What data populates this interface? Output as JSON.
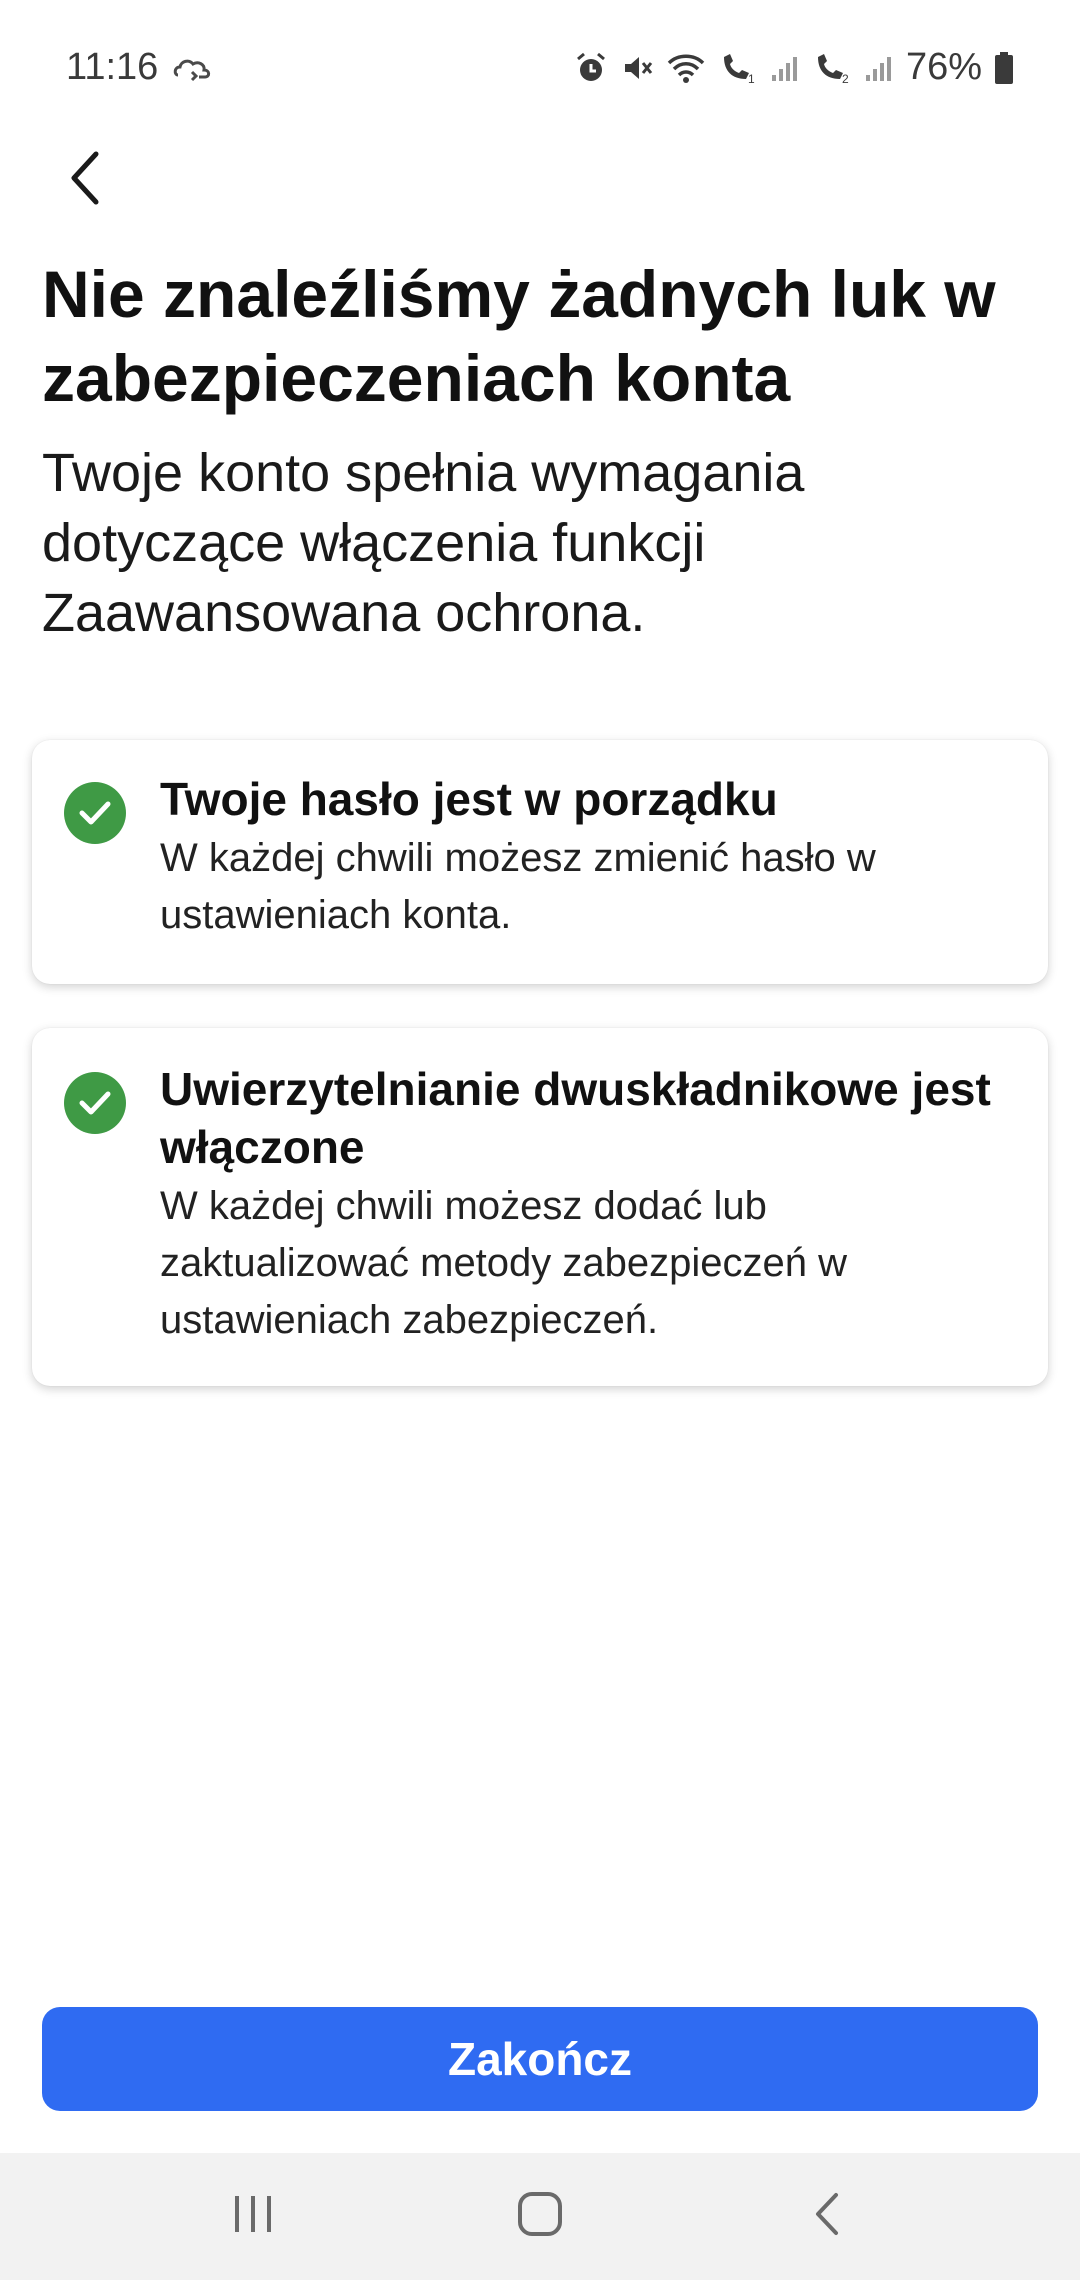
{
  "status_bar": {
    "time": "11:16",
    "battery_percent": "76%",
    "icons": [
      "cloud-sync-icon",
      "alarm-icon",
      "mute-icon",
      "wifi-icon",
      "call-sim1-icon",
      "signal-icon",
      "call-sim2-icon",
      "signal-icon",
      "battery-icon"
    ]
  },
  "header": {
    "back_icon": "chevron-left-icon"
  },
  "main": {
    "title": "Nie znaleźliśmy żadnych luk w zabezpieczeniach konta",
    "subtitle": "Twoje konto spełnia wymagania dotyczące włączenia funkcji Zaawansowana ochrona.",
    "checks": [
      {
        "icon": "check-circle-icon",
        "title": "Twoje hasło jest w porządku",
        "description": "W każdej chwili możesz zmienić hasło w ustawieniach konta."
      },
      {
        "icon": "check-circle-icon",
        "title": "Uwierzytelnianie dwuskładnikowe jest włączone",
        "description": "W każdej chwili możesz dodać lub zaktualizować metody zabezpieczeń w ustawieniach zabezpieczeń."
      }
    ]
  },
  "footer": {
    "finish_label": "Zakończ"
  },
  "nav_bar": {
    "icons": [
      "recent-apps-icon",
      "home-icon",
      "back-icon"
    ]
  },
  "colors": {
    "accent": "#2f6bf2",
    "success": "#3f9a45",
    "nav_background": "#f2f2f2"
  }
}
